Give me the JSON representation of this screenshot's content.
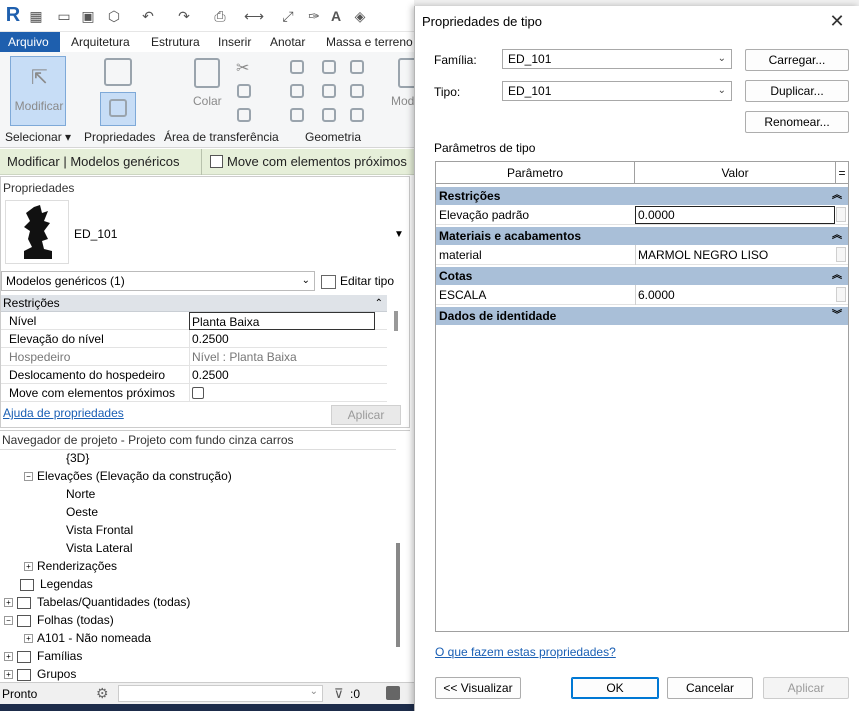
{
  "revit": {
    "tabs": [
      "Arquivo",
      "Arquitetura",
      "Estrutura",
      "Inserir",
      "Anotar",
      "Massa e terreno"
    ],
    "ribbon": {
      "modify_label": "Modificar",
      "colar_label": "Colar",
      "mod_label": "Mod",
      "groups": [
        "Selecionar",
        "Propriedades",
        "Área de transferência",
        "Geometria"
      ]
    },
    "context_title": "Modificar | Modelos genéricos",
    "context_checkbox": "Move com elementos próximos",
    "properties": {
      "title": "Propriedades",
      "type_name": "ED_101",
      "category": "Modelos genéricos (1)",
      "edit_type": "Editar tipo",
      "section": "Restrições",
      "rows": [
        {
          "name": "Nível",
          "value": "Planta Baixa"
        },
        {
          "name": "Elevação do nível",
          "value": "0.2500"
        },
        {
          "name": "Hospedeiro",
          "value": "Nível : Planta Baixa"
        },
        {
          "name": "Deslocamento do hospedeiro",
          "value": "0.2500"
        },
        {
          "name": "Move com elementos próximos",
          "value": ""
        }
      ],
      "help": "Ajuda de propriedades",
      "apply": "Aplicar"
    },
    "browser": {
      "title": "Navegador de projeto - Projeto com fundo cinza carros",
      "items": [
        "{3D}",
        "Elevações (Elevação da construção)",
        "Norte",
        "Oeste",
        "Vista Frontal",
        "Vista Lateral",
        "Renderizações",
        "Legendas",
        "Tabelas/Quantidades (todas)",
        "Folhas (todas)",
        "A101 - Não nomeada",
        "Famílias",
        "Grupos"
      ]
    },
    "status": "Pronto",
    "status_count": ":0"
  },
  "dialog": {
    "title": "Propriedades de tipo",
    "familia_label": "Família:",
    "familia_value": "ED_101",
    "tipo_label": "Tipo:",
    "tipo_value": "ED_101",
    "carregar": "Carregar...",
    "duplicar": "Duplicar...",
    "renomear": "Renomear...",
    "params_label": "Parâmetros de tipo",
    "col_param": "Parâmetro",
    "col_valor": "Valor",
    "col_eq": "=",
    "sections": [
      {
        "title": "Restrições",
        "rows": [
          {
            "name": "Elevação padrão",
            "value": "0.0000"
          }
        ]
      },
      {
        "title": "Materiais e acabamentos",
        "rows": [
          {
            "name": "material",
            "value": "MARMOL NEGRO LISO"
          }
        ]
      },
      {
        "title": "Cotas",
        "rows": [
          {
            "name": "ESCALA",
            "value": "6.0000"
          }
        ]
      },
      {
        "title": "Dados de identidade",
        "rows": []
      }
    ],
    "help_link": "O que fazem estas propriedades?",
    "visualizar": "<< Visualizar",
    "ok": "OK",
    "cancelar": "Cancelar",
    "aplicar": "Aplicar"
  }
}
